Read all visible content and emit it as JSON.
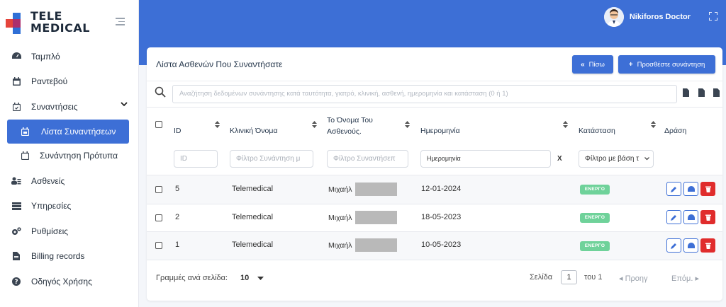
{
  "brand": {
    "line1": "TELE",
    "line2": "MEDICAL"
  },
  "sidebar": {
    "items": [
      {
        "label": "Ταμπλό",
        "icon": "dashboard-icon"
      },
      {
        "label": "Ραντεβού",
        "icon": "calendar-icon"
      },
      {
        "label": "Συναντήσεις",
        "icon": "calendar-check-icon"
      },
      {
        "label": "Λίστα Συναντήσεων",
        "icon": "calendar-list-icon"
      },
      {
        "label": "Συνάντηση Πρότυπα",
        "icon": "calendar-template-icon"
      },
      {
        "label": "Ασθενείς",
        "icon": "users-icon"
      },
      {
        "label": "Υπηρεσίες",
        "icon": "server-icon"
      },
      {
        "label": "Ρυθμίσεις",
        "icon": "cogs-icon"
      },
      {
        "label": "Billing records",
        "icon": "file-icon"
      },
      {
        "label": "Οδηγός Χρήσης",
        "icon": "question-icon"
      }
    ]
  },
  "header": {
    "user_name": "Nikiforos Doctor"
  },
  "card": {
    "title": "Λίστα Ασθενών Που Συναντήσατε",
    "back_label": "Πίσω",
    "add_label": "Προσθέστε συνάντηση",
    "search_placeholder": "Αναζήτηση δεδομένων συνάντησης κατά ταυτότητα, γιατρό, κλινική, ασθενή, ημερομηνία και κατάσταση (0 ή 1)"
  },
  "table": {
    "headers": {
      "id": "ID",
      "clinic": "Κλινική Όνομα",
      "patient_line1": "Το Όνομα Του",
      "patient_line2": "Ασθενούς.",
      "date": "Ημερομηνία",
      "status": "Κατάσταση",
      "action": "Δράση"
    },
    "filters": {
      "id": "ID",
      "clinic": "Φίλτρο Συνάντηση μ",
      "patient": "Φίλτρο Συναντήσεπ",
      "date": "Ημερομηνία",
      "clear": "X",
      "status": "Φίλτρο με βάση τ"
    },
    "rows": [
      {
        "id": "5",
        "clinic": "Telemedical",
        "patient": "Μιχαήλ",
        "date": "12-01-2024",
        "status": "ΕΝΕΡΓΟ"
      },
      {
        "id": "2",
        "clinic": "Telemedical",
        "patient": "Μιχαήλ",
        "date": "18-05-2023",
        "status": "ΕΝΕΡΓΟ"
      },
      {
        "id": "1",
        "clinic": "Telemedical",
        "patient": "Μιχαήλ",
        "date": "10-05-2023",
        "status": "ΕΝΕΡΓΟ"
      }
    ]
  },
  "footer": {
    "rows_per_page_label": "Γραμμές ανά σελίδα:",
    "rows_per_page": "10",
    "page_label": "Σελίδα",
    "page": "1",
    "of_label": "του 1",
    "prev": "Προηγ",
    "next": "Επόμ."
  },
  "colors": {
    "primary": "#3d6fd6",
    "danger": "#e02c2c",
    "success": "#6fd29a"
  }
}
